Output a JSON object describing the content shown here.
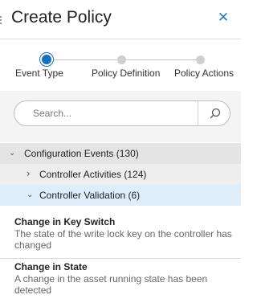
{
  "header": {
    "title": "Create Policy",
    "close_glyph": "✕"
  },
  "stepper": {
    "steps": [
      {
        "label": "Event Type",
        "active": true
      },
      {
        "label": "Policy Definition",
        "active": false
      },
      {
        "label": "Policy Actions",
        "active": false
      }
    ]
  },
  "search": {
    "placeholder": "Search...",
    "value": ""
  },
  "tree": {
    "groups": [
      {
        "label": "Configuration Events (130)",
        "expanded": true,
        "chevron": "⌄"
      },
      {
        "label": "Controller Activities (124)",
        "expanded": false,
        "chevron": "›"
      },
      {
        "label": "Controller Validation (6)",
        "expanded": true,
        "chevron": "⌄"
      }
    ],
    "items": [
      {
        "title": "Change in Key Switch",
        "description": "The state of the write lock key on the controller has changed"
      },
      {
        "title": "Change in State",
        "description": "A change in the asset running state has been detected"
      }
    ]
  },
  "colors": {
    "accent": "#1a6fc0",
    "close_icon": "#2a7bbf",
    "search_panel_bg": "#f4f4f4",
    "group_l1_bg": "#e4e4e4",
    "group_l2_bg": "#eeeeee",
    "group_selected_bg": "#ddeefa"
  }
}
